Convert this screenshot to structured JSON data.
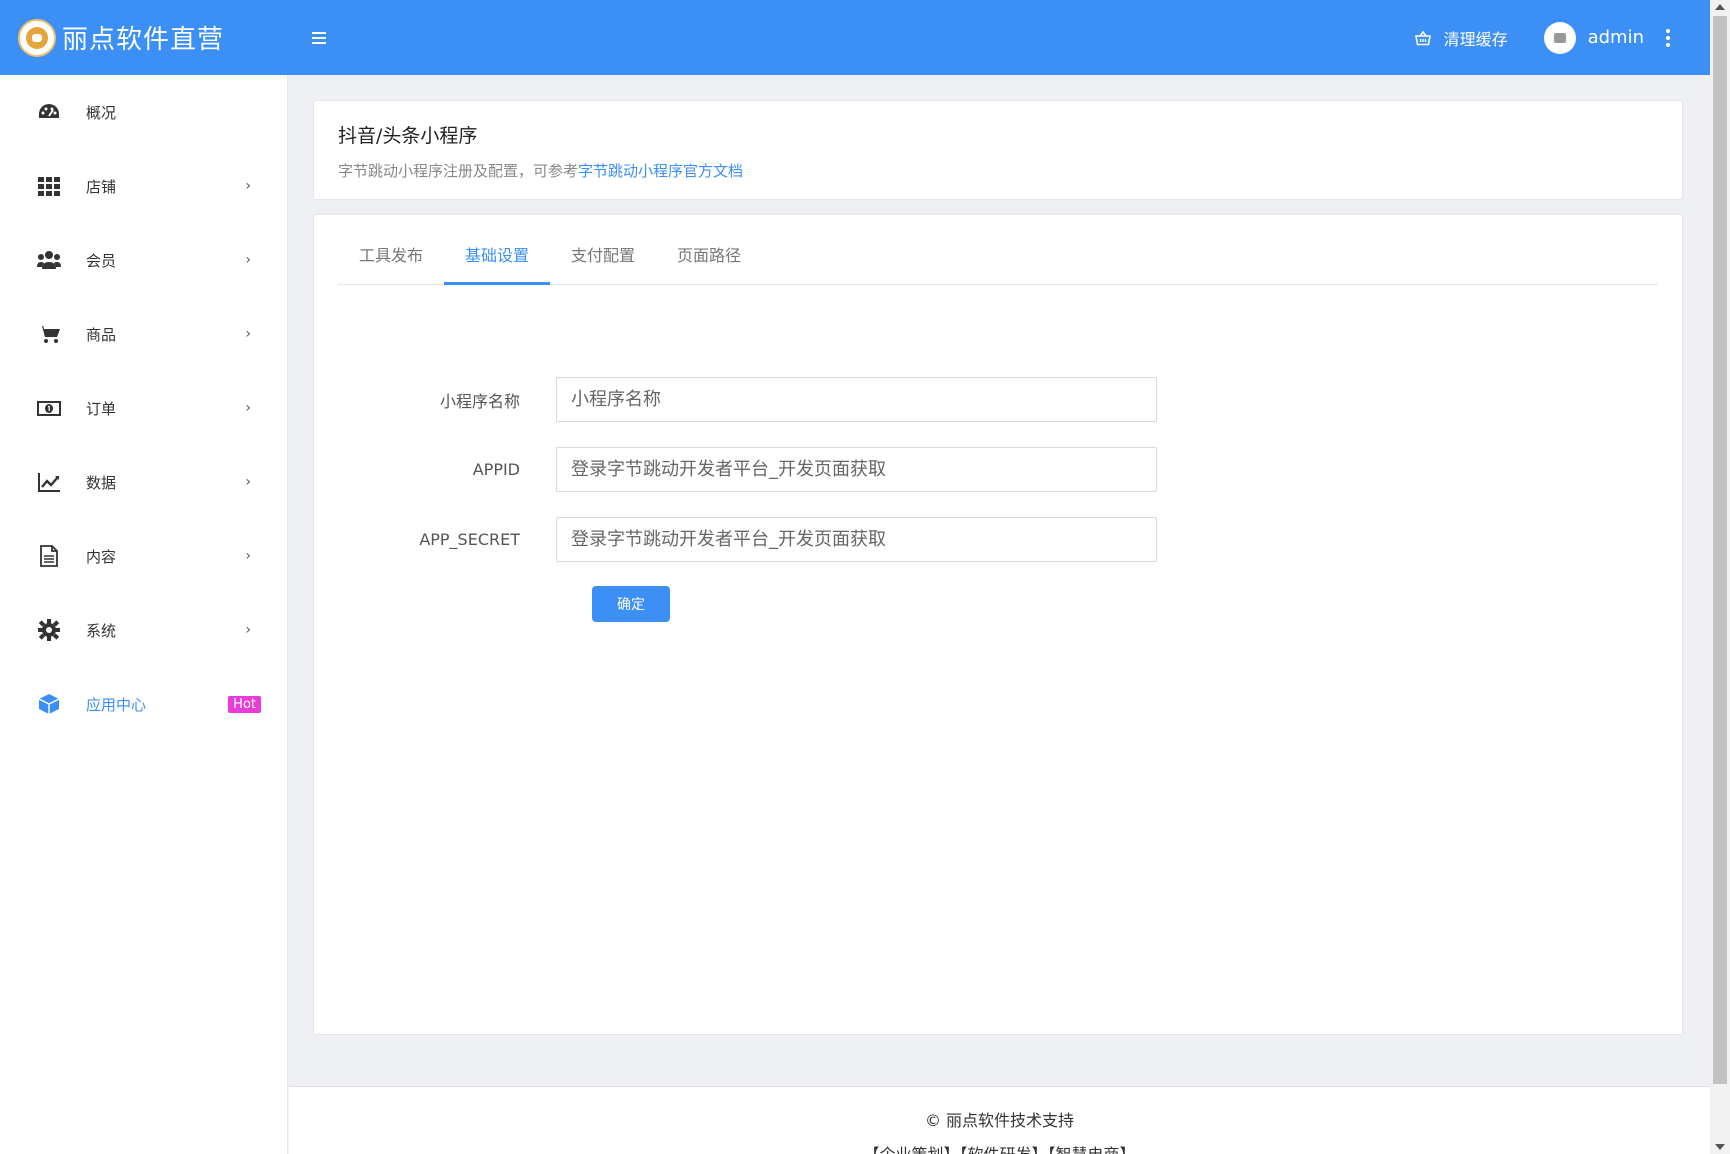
{
  "header": {
    "brand_title": "丽点软件直营",
    "clear_cache_label": "清理缓存",
    "username": "admin",
    "accent_color": "#3b8ff5"
  },
  "sidebar": {
    "items": [
      {
        "label": "概况",
        "icon": "dashboard-icon",
        "has_chevron": false
      },
      {
        "label": "店铺",
        "icon": "grid-icon",
        "has_chevron": true
      },
      {
        "label": "会员",
        "icon": "users-icon",
        "has_chevron": true
      },
      {
        "label": "商品",
        "icon": "cart-icon",
        "has_chevron": true
      },
      {
        "label": "订单",
        "icon": "money-icon",
        "has_chevron": true
      },
      {
        "label": "数据",
        "icon": "chart-line-icon",
        "has_chevron": true
      },
      {
        "label": "内容",
        "icon": "document-icon",
        "has_chevron": true
      },
      {
        "label": "系统",
        "icon": "gear-icon",
        "has_chevron": true
      },
      {
        "label": "应用中心",
        "icon": "cube-icon",
        "badge": "Hot",
        "active": true
      }
    ],
    "chevron": "›"
  },
  "page": {
    "title": "抖音/头条小程序",
    "desc_prefix": "字节跳动小程序注册及配置，可参考",
    "desc_link": "字节跳动小程序官方文档"
  },
  "tabs": [
    {
      "label": "工具发布",
      "active": false
    },
    {
      "label": "基础设置",
      "active": true
    },
    {
      "label": "支付配置",
      "active": false
    },
    {
      "label": "页面路径",
      "active": false
    }
  ],
  "form": {
    "fields": [
      {
        "label": "小程序名称",
        "placeholder": "小程序名称",
        "value": ""
      },
      {
        "label": "APPID",
        "placeholder": "登录字节跳动开发者平台_开发页面获取",
        "value": ""
      },
      {
        "label": "APP_SECRET",
        "placeholder": "登录字节跳动开发者平台_开发页面获取",
        "value": ""
      }
    ],
    "submit_label": "确定"
  },
  "footer": {
    "copyright": "© 丽点软件技术支持",
    "links": "【企业策划】【软件研发】【智慧电商】"
  }
}
